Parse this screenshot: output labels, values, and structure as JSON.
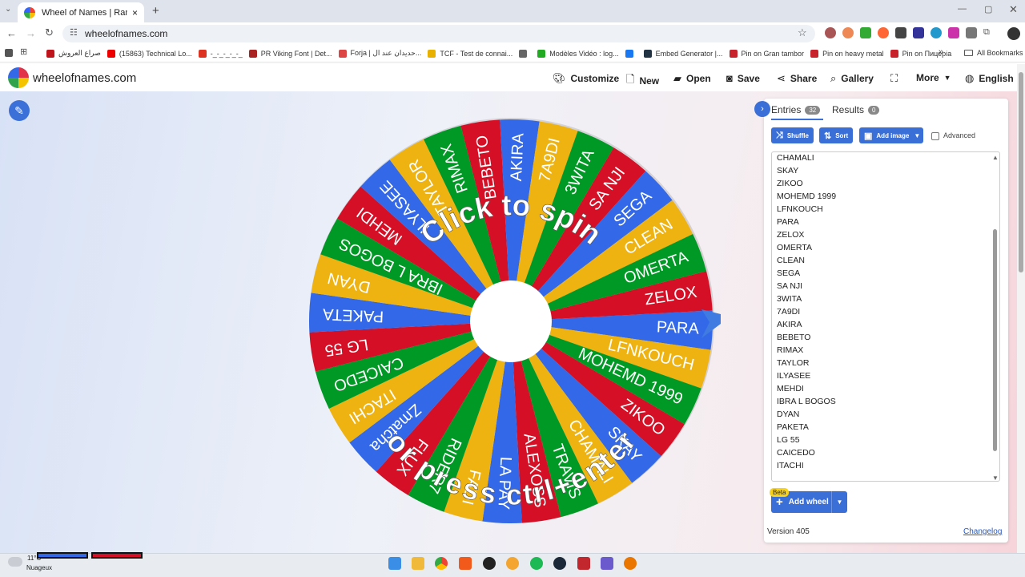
{
  "browser": {
    "tab_title": "Wheel of Names | Random nam",
    "tab_close": "×",
    "new_tab": "+",
    "url": "wheelofnames.com",
    "bookmarks": [
      {
        "label": "صراع العروش",
        "color": "#c0141c"
      },
      {
        "label": "(15863) Technical Lo...",
        "color": "#e00"
      },
      {
        "label": "-_-_-_-_-_",
        "color": "#d32"
      },
      {
        "label": "PR Viking Font | Det...",
        "color": "#a22"
      },
      {
        "label": "Forja | حديدان عند ال...",
        "color": "#d44"
      },
      {
        "label": "TCF - Test de connai...",
        "color": "#e8b000"
      },
      {
        "label": "",
        "color": "#666"
      },
      {
        "label": "Modèles Vidéo : log...",
        "color": "#2a2"
      },
      {
        "label": "",
        "color": "#1877f2"
      },
      {
        "label": "Embed Generator |...",
        "color": "#234"
      },
      {
        "label": "Pin on Gran tambor",
        "color": "#c8232c"
      },
      {
        "label": "Pin on heavy metal",
        "color": "#c8232c"
      },
      {
        "label": "Pin on Пицерia",
        "color": "#c8232c"
      }
    ],
    "all_bookmarks": "All Bookmarks"
  },
  "app": {
    "brand": "wheelofnames.com",
    "nav": {
      "customize": "Customize",
      "new": "New",
      "open": "Open",
      "save": "Save",
      "share": "Share",
      "gallery": "Gallery",
      "more": "More",
      "language": "English"
    }
  },
  "wheel": {
    "center_text_top": "Click to spin",
    "center_text_bottom": "or press ctrl+enter",
    "slices": [
      "PARA",
      "LFNKOUCH",
      "MOHEMD 1999",
      "ZIKOO",
      "SKAY",
      "CHAMALI",
      "TRAVIS",
      "ALEXOSS",
      "LA PAY",
      "FADI",
      "RIDER7",
      "FLUX",
      "Zmatcha",
      "ITACHI",
      "CAICEDO",
      "LG 55",
      "PAKETA",
      "DYAN",
      "IBRA L BOGOS",
      "MEHDI",
      "ILYASEE",
      "TAYLOR",
      "RIMAX",
      "BEBETO",
      "AKIRA",
      "7A9DI",
      "3WITA",
      "SA NJI",
      "SEGA",
      "CLEAN",
      "OMERTA",
      "ZELOX"
    ],
    "colors": {
      "blue": "#3369e8",
      "red": "#d50f25",
      "yellow": "#eeb211",
      "green": "#009925"
    }
  },
  "panel": {
    "tab_entries": "Entries",
    "entries_count": "32",
    "tab_results": "Results",
    "results_count": "0",
    "shuffle": "Shuffle",
    "sort": "Sort",
    "add_image": "Add image",
    "advanced": "Advanced",
    "entries": [
      "CHAMALI",
      "SKAY",
      "ZIKOO",
      "MOHEMD 1999",
      "LFNKOUCH",
      "PARA",
      "ZELOX",
      "OMERTA",
      "CLEAN",
      "SEGA",
      "SA NJI",
      "3WITA",
      "7A9DI",
      "AKIRA",
      "BEBETO",
      "RIMAX",
      "TAYLOR",
      "ILYASEE",
      "MEHDI",
      "IBRA L BOGOS",
      "DYAN",
      "PAKETA",
      "LG 55",
      "CAICEDO",
      "ITACHI"
    ],
    "beta": "Beta",
    "add_wheel": "Add wheel",
    "version": "Version 405",
    "changelog": "Changelog"
  },
  "taskbar": {
    "weather_temp": "11°C",
    "weather_text": "Nuageux"
  }
}
